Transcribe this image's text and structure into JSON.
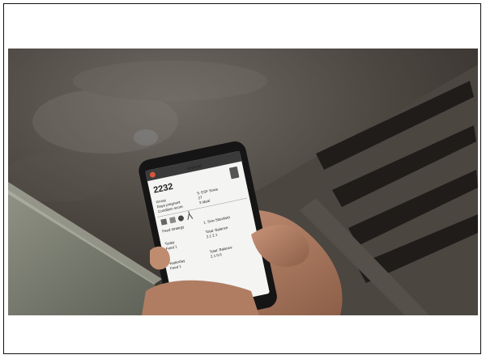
{
  "phone": {
    "title": "Animal",
    "animal_id": "2232",
    "fields": [
      {
        "label": "Group",
        "value": "5. ESF Sows"
      },
      {
        "label": "Days pregnant",
        "value": "27"
      },
      {
        "label": "Condition score",
        "value": "3 Ideal"
      }
    ],
    "feed_strategy_label": "Feed strategy",
    "feed_strategy_value": "1. Sow Standard",
    "today_label": "Today",
    "today_sub": "Feed 1",
    "today_balance_label": "Total: Balance",
    "today_balance_value": "2.1  2.1",
    "yesterday_label": "Yesterday",
    "yesterday_sub": "Feed 1",
    "yesterday_balance_label": "Total: Balance",
    "yesterday_balance_value": "2.1  0.0"
  },
  "colors": {
    "header_bar": "#3a3a3a",
    "accent": "#d8553a",
    "screen_bg": "#f4f4f2"
  },
  "icons": [
    "settings-icon",
    "scale-icon",
    "person-icon",
    "network-icon",
    "building-icon"
  ]
}
